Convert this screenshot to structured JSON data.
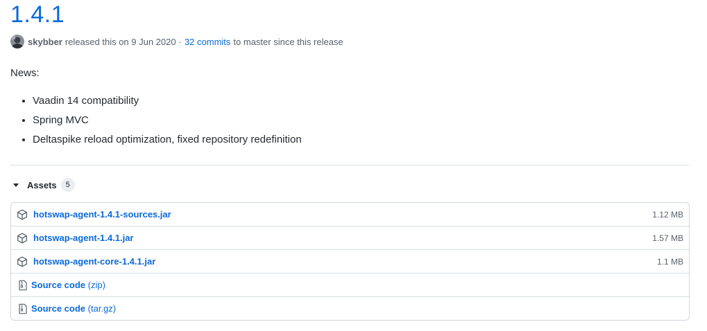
{
  "release": {
    "title": "1.4.1",
    "author": "skybber",
    "released_text": "released this on 9 Jun 2020",
    "separator": "·",
    "commits_link": "32 commits",
    "commits_suffix": "to master since this release"
  },
  "notes": {
    "heading": "News:",
    "items": [
      "Vaadin 14 compatibility",
      "Spring MVC",
      "Deltaspike reload optimization, fixed repository redefinition"
    ]
  },
  "assets": {
    "label": "Assets",
    "count": "5",
    "files": [
      {
        "name": "hotswap-agent-1.4.1-sources.jar",
        "size": "1.12 MB",
        "icon": "package-icon"
      },
      {
        "name": "hotswap-agent-1.4.1.jar",
        "size": "1.57 MB",
        "icon": "package-icon"
      },
      {
        "name": "hotswap-agent-core-1.4.1.jar",
        "size": "1.1 MB",
        "icon": "package-icon"
      }
    ],
    "sources": [
      {
        "name": "Source code",
        "suffix": "(zip)",
        "icon": "file-zip-icon"
      },
      {
        "name": "Source code",
        "suffix": "(tar.gz)",
        "icon": "file-zip-icon"
      }
    ]
  },
  "colors": {
    "link": "#0969da",
    "muted": "#57606a",
    "text": "#24292f",
    "border": "#d0d7de"
  }
}
